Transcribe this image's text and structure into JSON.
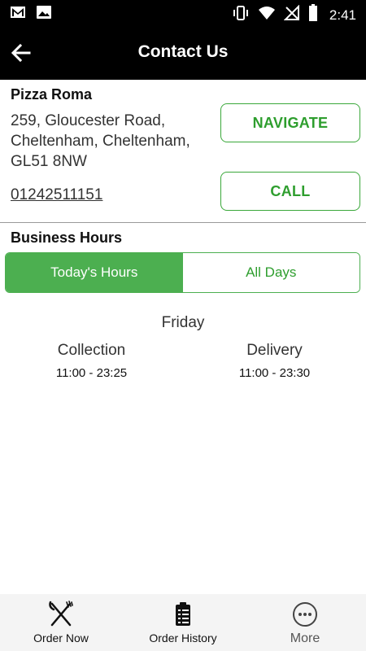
{
  "status_bar": {
    "time": "2:41",
    "left_icons": [
      "gmail-icon",
      "image-icon"
    ],
    "right_icons": [
      "vibrate-icon",
      "wifi-icon",
      "no-signal-icon",
      "battery-icon"
    ]
  },
  "toolbar": {
    "title": "Contact Us",
    "back_icon": "arrow-left-icon"
  },
  "store": {
    "name": "Pizza Roma",
    "address_lines": [
      "259, Gloucester Road,",
      "Cheltenham, Cheltenham,",
      "GL51 8NW"
    ],
    "phone": "01242511151",
    "navigate_label": "NAVIGATE",
    "call_label": "CALL"
  },
  "business_hours": {
    "title": "Business Hours",
    "tabs": [
      {
        "label": "Today's Hours",
        "active": true
      },
      {
        "label": "All Days",
        "active": false
      }
    ],
    "day": "Friday",
    "collection": {
      "label": "Collection",
      "hours": "11:00 - 23:25"
    },
    "delivery": {
      "label": "Delivery",
      "hours": "11:00 - 23:30"
    }
  },
  "bottom_nav": {
    "items": [
      {
        "label": "Order Now",
        "icon": "fork-knife-icon"
      },
      {
        "label": "Order History",
        "icon": "clipboard-icon"
      },
      {
        "label": "More",
        "icon": "more-dots-icon"
      }
    ]
  },
  "colors": {
    "accent_green": "#4caf50",
    "text_green": "#2e9e2e",
    "header_black": "#000000"
  }
}
